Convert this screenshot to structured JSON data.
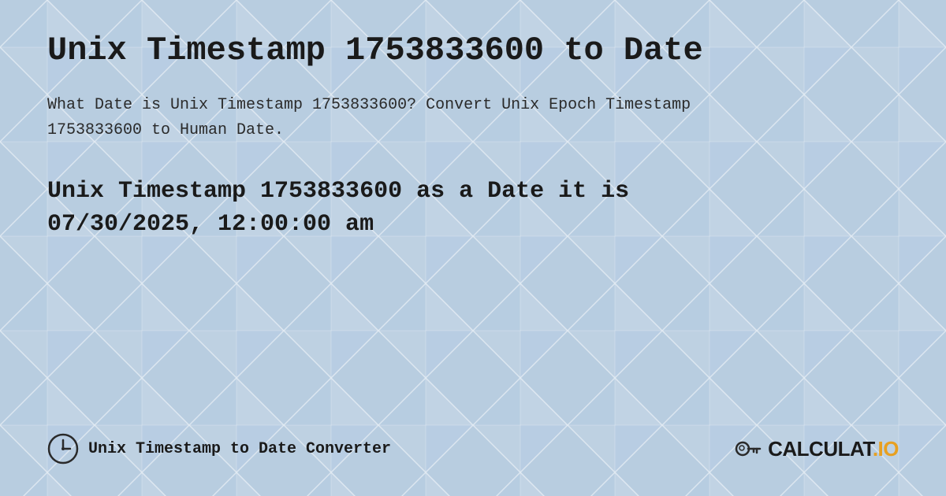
{
  "page": {
    "title": "Unix Timestamp 1753833600 to Date",
    "description": "What Date is Unix Timestamp 1753833600? Convert Unix Epoch Timestamp 1753833600 to Human Date.",
    "result_line1": "Unix Timestamp 1753833600 as a Date it is",
    "result_line2": "07/30/2025, 12:00:00 am",
    "background_color": "#c8d8e8"
  },
  "footer": {
    "label": "Unix Timestamp to Date Converter",
    "logo_text": "CALCULAT.IO"
  }
}
